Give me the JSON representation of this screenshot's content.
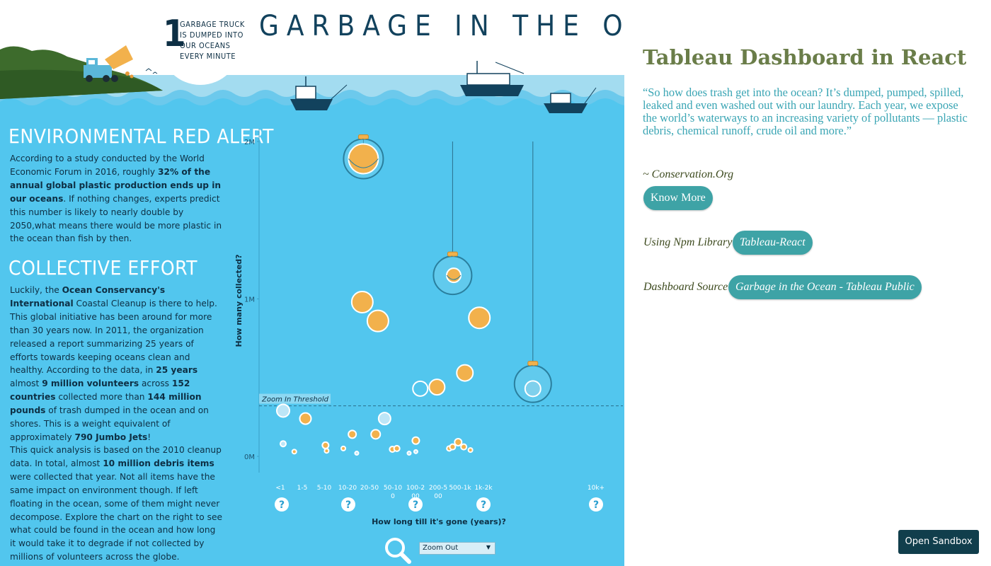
{
  "dashboard": {
    "title": "GARBAGE IN THE OCEAN",
    "badge": {
      "number": "1",
      "lines": [
        "GARBAGE TRUCK",
        "IS DUMPED INTO",
        "OUR OCEANS",
        "EVERY MINUTE"
      ]
    },
    "section1": {
      "heading": "ENVIRONMENTAL RED ALERT",
      "p1_a": "According to a study conducted by the World Economic Forum in 2016, roughly ",
      "p1_b": "32% of the annual global plastic production ends up in our oceans",
      "p1_c": ". If nothing changes, experts predict this number is likely to nearly double by 2050,what means there would be more plastic in the ocean than fish by then."
    },
    "section2": {
      "heading": "COLLECTIVE EFFORT",
      "p2_a": "Luckily, the ",
      "p2_b": "Ocean Conservancy's International",
      "p2_c": " Coastal Cleanup is there to help. This global initiative has been around for more than 30 years now. In 2011, the organization released a report summarizing 25 years of efforts towards keeping oceans clean and healthy. According to the data, in ",
      "p2_d": "25 years",
      "p2_e": " almost ",
      "p2_f": "9 million volunteers",
      "p2_g": " across ",
      "p2_h": "152 countries",
      "p2_i": " collected more than ",
      "p2_j": "144 million pounds",
      "p2_k": " of trash dumped in the ocean and on shores. This is a weight equivalent of approximately ",
      "p2_l": "790 Jumbo Jets",
      "p2_m": "!",
      "p3_a": "This quick analysis is based on the 2010 cleanup data. In total, almost ",
      "p3_b": "10 million debris items",
      "p3_c": " were collected that year. Not all items have the same impact on environment though. If left floating in the ocean, some of them might never decompose. Explore the chart on the right to see what could be found in the ocean and how long it would take it to degrade if not collected by millions of volunteers across the globe."
    },
    "zoom_select": {
      "value": "Zoom Out"
    }
  },
  "chart_data": {
    "type": "scatter",
    "ylabel": "How many collected?",
    "xlabel": "How long till it's gone (years)?",
    "y_ticks": [
      "2M",
      "1M",
      "0M"
    ],
    "ylim": [
      0,
      2000000
    ],
    "threshold_label": "Zoom In Threshold",
    "threshold_value": 330000,
    "categories": [
      "<1",
      "1-5",
      "5-10",
      "10-20",
      "20-50",
      "50-100",
      "100-200",
      "200-500",
      "500-1k",
      "1k-2k",
      "10k+"
    ],
    "points": [
      {
        "x": "<1",
        "xi": 0.0,
        "y": 290000,
        "r": 9,
        "kind": "light"
      },
      {
        "x": "<1",
        "xi": 0.0,
        "y": 80000,
        "r": 4,
        "kind": "light"
      },
      {
        "x": "<1",
        "xi": 0.5,
        "y": 30000,
        "r": 3,
        "kind": "orange"
      },
      {
        "x": "1-5",
        "xi": 1.0,
        "y": 240000,
        "r": 8,
        "kind": "orange"
      },
      {
        "x": "5-10",
        "xi": 1.9,
        "y": 70000,
        "r": 4.5,
        "kind": "orange"
      },
      {
        "x": "5-10",
        "xi": 1.95,
        "y": 35000,
        "r": 3,
        "kind": "orange"
      },
      {
        "x": "10-20",
        "xi": 2.7,
        "y": 50000,
        "r": 3,
        "kind": "orange"
      },
      {
        "x": "10-20",
        "xi": 3.1,
        "y": 140000,
        "r": 5.5,
        "kind": "orange"
      },
      {
        "x": "10-20",
        "xi": 3.3,
        "y": 20000,
        "r": 2.5,
        "kind": "light"
      },
      {
        "x": "10-20",
        "xi": 3.55,
        "y": 980000,
        "r": 15,
        "kind": "orange"
      },
      {
        "x": "20-50",
        "xi": 4.25,
        "y": 860000,
        "r": 15,
        "kind": "orange"
      },
      {
        "x": "20-50",
        "xi": 4.15,
        "y": 140000,
        "r": 6.5,
        "kind": "orange"
      },
      {
        "x": "20-50",
        "xi": 4.55,
        "y": 240000,
        "r": 8.5,
        "kind": "light"
      },
      {
        "x": "50-100",
        "xi": 4.9,
        "y": 45000,
        "r": 4,
        "kind": "orange"
      },
      {
        "x": "50-100",
        "xi": 5.1,
        "y": 50000,
        "r": 4,
        "kind": "orange"
      },
      {
        "x": "100-200",
        "xi": 5.65,
        "y": 20000,
        "r": 2.5,
        "kind": "light"
      },
      {
        "x": "100-200",
        "xi": 5.95,
        "y": 100000,
        "r": 5,
        "kind": "orange"
      },
      {
        "x": "100-200",
        "xi": 5.95,
        "y": 30000,
        "r": 2.5,
        "kind": "light"
      },
      {
        "x": "100-200",
        "xi": 6.15,
        "y": 430000,
        "r": 10.5,
        "kind": "hollow"
      },
      {
        "x": "200-500",
        "xi": 6.9,
        "y": 440000,
        "r": 11,
        "kind": "orange"
      },
      {
        "x": "500-1k",
        "xi": 7.45,
        "y": 50000,
        "r": 3.5,
        "kind": "orange"
      },
      {
        "x": "500-1k",
        "xi": 7.6,
        "y": 60000,
        "r": 4,
        "kind": "orange"
      },
      {
        "x": "500-1k",
        "xi": 7.85,
        "y": 90000,
        "r": 5,
        "kind": "orange"
      },
      {
        "x": "500-1k",
        "xi": 8.1,
        "y": 60000,
        "r": 4,
        "kind": "orange"
      },
      {
        "x": "500-1k",
        "xi": 8.15,
        "y": 530000,
        "r": 11.5,
        "kind": "orange"
      },
      {
        "x": "1k-2k",
        "xi": 8.4,
        "y": 40000,
        "r": 3,
        "kind": "orange"
      },
      {
        "x": "1k-2k",
        "xi": 8.8,
        "y": 880000,
        "r": 15,
        "kind": "orange"
      },
      {
        "x": "100-200",
        "xi": 7.65,
        "y": 1150000,
        "r": 10,
        "kind": "orange-net"
      },
      {
        "x": "10-20",
        "xi": 3.6,
        "y": 1890000,
        "r": 21,
        "kind": "orange-net"
      },
      {
        "x": "10k+",
        "xi": 11.2,
        "y": 430000,
        "r": 11,
        "kind": "hollow-net"
      }
    ],
    "nets": [
      {
        "xi": 3.6,
        "y": 1890000,
        "r": 28,
        "rope_top": 1960000
      },
      {
        "xi": 7.6,
        "y": 1150000,
        "r": 27,
        "rope_top": 2000000
      },
      {
        "xi": 11.2,
        "y": 460000,
        "r": 26,
        "rope_top": 2000000
      }
    ],
    "help_icon_indices": [
      0,
      3,
      6,
      9,
      10
    ]
  },
  "colors": {
    "ocean": "#52c6ee",
    "sky": "#ffffff",
    "title_dark": "#12425d",
    "orange": "#f2b14c",
    "light_bubble": "#bde6f7",
    "rp_title": "#6a7d49",
    "rp_quote": "#3aa5b4",
    "pill": "#3ea3a6",
    "sandbox": "#113e4c"
  },
  "right_panel": {
    "title": "Tableau Dashboard in React",
    "quote": "“So how does trash get into the ocean? It’s dumped, pumped, spilled, leaked and even washed out with our laundry. Each year, we expose the world’s waterways to an increasing variety of pollutants — plastic debris, chemical runoff, crude oil and more.”",
    "source": "~ Conservation.Org",
    "know_more_label": "Know More",
    "npm_label": "Using Npm Library",
    "npm_button": "Tableau-React",
    "source_label": "Dashboard Source",
    "source_button": "Garbage in the Ocean - Tableau Public",
    "sandbox_button": "Open Sandbox"
  }
}
